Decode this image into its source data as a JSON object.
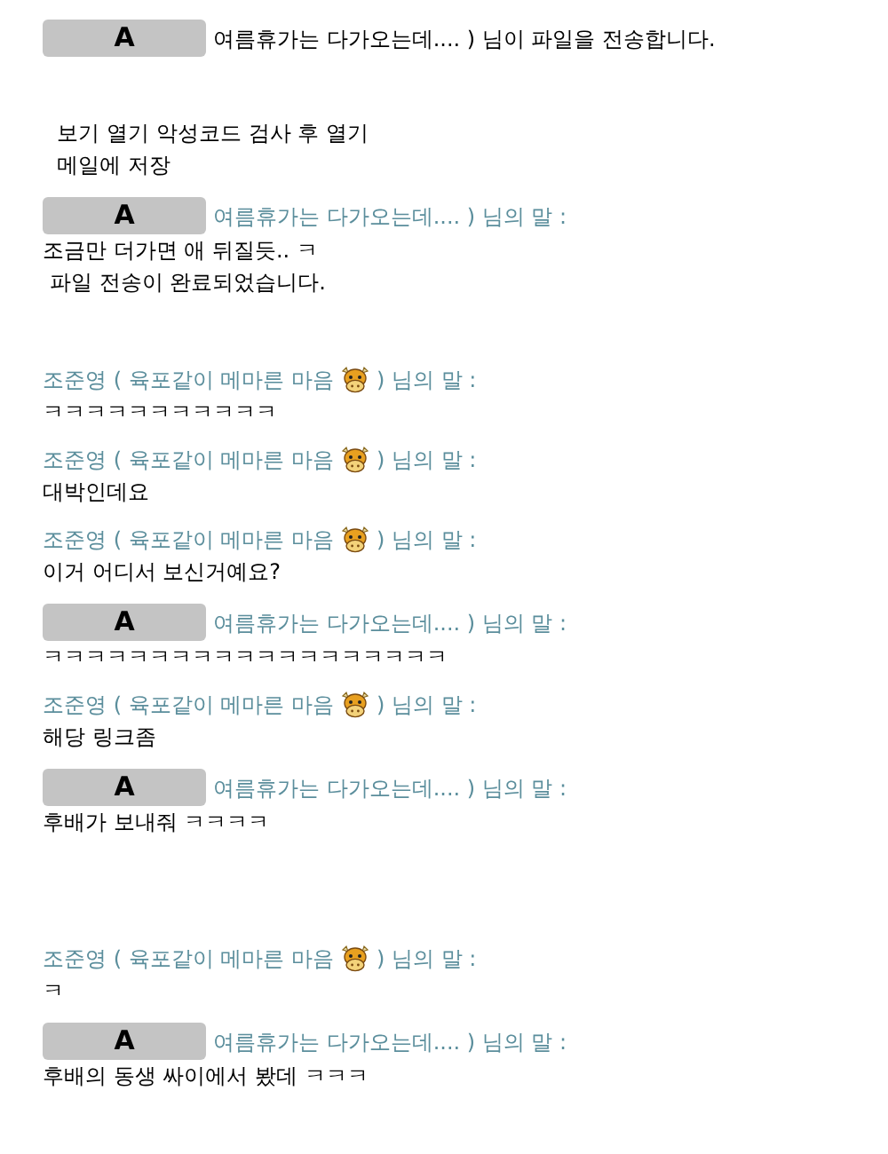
{
  "entries": [
    {
      "kind": "file_notice",
      "sender": {
        "badge": "A"
      },
      "text": "여름휴가는 다가오는데.... ) 님이 파일을 전송합니다."
    },
    {
      "kind": "file_actions",
      "rows": [
        [
          "보기",
          "열기",
          "악성코드 검사 후 열기"
        ],
        [
          "메일에 저장"
        ]
      ]
    },
    {
      "kind": "message",
      "sender": {
        "kind": "masked",
        "badge": "A",
        "label": "여름휴가는 다가오는데.... ) 님의 말 :"
      },
      "lines": [
        "조금만 더가면 애 뒤질듯.. ㅋ"
      ]
    },
    {
      "kind": "system",
      "text": "파일 전송이 완료되었습니다."
    },
    {
      "kind": "message",
      "sender": {
        "kind": "named",
        "name": "조준영 ( 육포같이 메마른 마음",
        "suffix": ") 님의 말 :"
      },
      "lines": [
        "ㅋㅋㅋㅋㅋㅋㅋㅋㅋㅋㅋ"
      ]
    },
    {
      "kind": "message",
      "sender": {
        "kind": "named",
        "name": "조준영 ( 육포같이 메마른 마음",
        "suffix": ") 님의 말 :"
      },
      "lines": [
        "대박인데요"
      ]
    },
    {
      "kind": "message",
      "sender": {
        "kind": "named",
        "name": "조준영 ( 육포같이 메마른 마음",
        "suffix": ") 님의 말 :"
      },
      "lines": [
        "이거 어디서 보신거예요?"
      ]
    },
    {
      "kind": "message",
      "sender": {
        "kind": "masked",
        "badge": "A",
        "label": "여름휴가는 다가오는데.... ) 님의 말 :"
      },
      "lines": [
        "ㅋㅋㅋㅋㅋㅋㅋㅋㅋㅋㅋㅋㅋㅋㅋㅋㅋㅋㅋ"
      ]
    },
    {
      "kind": "message",
      "sender": {
        "kind": "named",
        "name": "조준영 ( 육포같이 메마른 마음",
        "suffix": ") 님의 말 :"
      },
      "lines": [
        "해당 링크좀"
      ]
    },
    {
      "kind": "message",
      "sender": {
        "kind": "masked",
        "badge": "A",
        "label": "여름휴가는 다가오는데.... ) 님의 말 :"
      },
      "lines": [
        "후배가 보내줘 ㅋㅋㅋㅋ"
      ]
    },
    {
      "kind": "blank"
    },
    {
      "kind": "message",
      "sender": {
        "kind": "named",
        "name": "조준영 ( 육포같이 메마른 마음",
        "suffix": ") 님의 말 :"
      },
      "lines": [
        "ㅋ"
      ]
    },
    {
      "kind": "message",
      "sender": {
        "kind": "masked",
        "badge": "A",
        "label": "여름휴가는 다가오는데.... ) 님의 말 :"
      },
      "lines": [
        "후배의 동생 싸이에서 봤데 ㅋㅋㅋ"
      ]
    }
  ]
}
